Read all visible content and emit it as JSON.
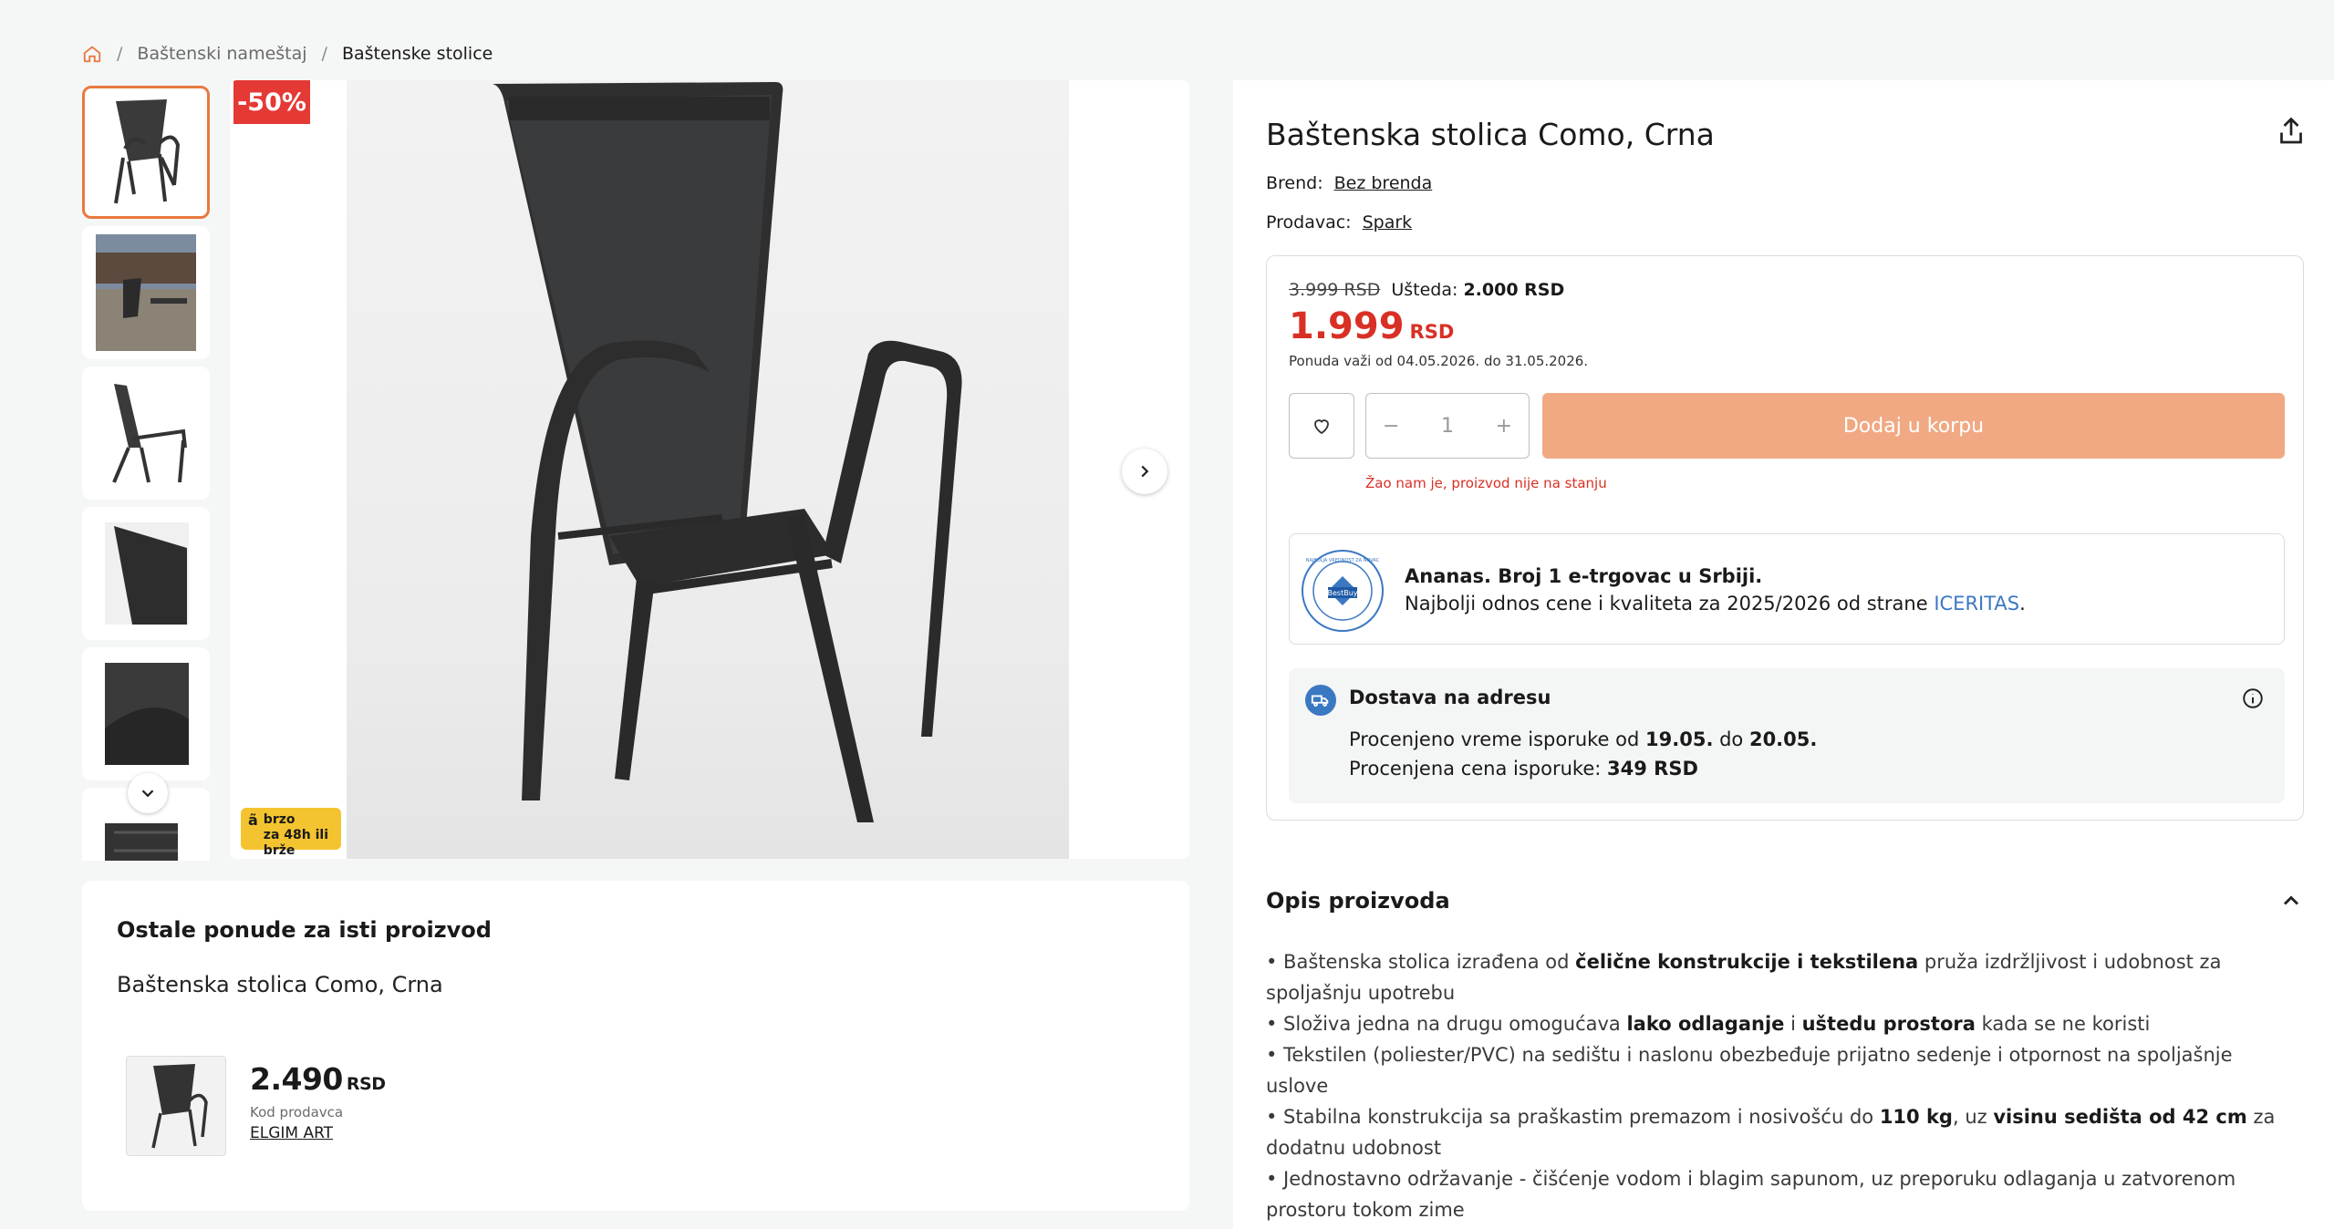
{
  "breadcrumb": {
    "items": [
      "Baštenski nameštaj",
      "Baštenske stolice"
    ]
  },
  "gallery": {
    "discount_badge": "-50%",
    "fast_badge_line1": "brzo",
    "fast_badge_line2": "za 48h ili brže",
    "fast_badge_logo": "ã"
  },
  "other_offers": {
    "title": "Ostale ponude za isti proizvod",
    "product_name": "Baštenska stolica Como, Crna",
    "offer": {
      "price": "2.490",
      "currency": "RSD",
      "seller_label": "Kod prodavca",
      "seller": "ELGIM ART"
    }
  },
  "product": {
    "title": "Baštenska stolica Como, Crna",
    "brand_label": "Brend:",
    "brand": "Bez brenda",
    "seller_label": "Prodavac:",
    "seller": "Spark"
  },
  "pricing": {
    "old_price": "3.999 RSD",
    "save_label": "Ušteda:",
    "save_value": "2.000 RSD",
    "price": "1.999",
    "currency": "RSD",
    "valid": "Ponuda važi od 04.05.2026. do 31.05.2026."
  },
  "cart": {
    "minus": "−",
    "quantity": "1",
    "plus": "+",
    "add_label": "Dodaj u korpu",
    "out_of_stock": "Žao nam je, proizvod nije na stanju"
  },
  "bestbuy": {
    "title": "Ananas. Broj 1 e-trgovac u Srbiji.",
    "subtitle_before": "Najbolji odnos cene i kvaliteta za 2025/2026 od strane ",
    "subtitle_link": "ICERITAS",
    "subtitle_after": ".",
    "badge_text": "BestBuy",
    "badge_ring_text": "NAJBOLJA VREDNOST ZA NOVAC"
  },
  "delivery": {
    "title": "Dostava na adresu",
    "time_label": "Procenjeno vreme isporuke od ",
    "time_from": "19.05.",
    "time_mid": " do ",
    "time_to": "20.05.",
    "cost_label": "Procenjena cena isporuke: ",
    "cost": "349 RSD"
  },
  "description": {
    "title": "Opis proizvoda",
    "items": [
      {
        "a": "• Baštenska stolica izrađena od ",
        "b": "čelične konstrukcije i tekstilena",
        "c": " pruža izdržljivost i udobnost za spoljašnju upotrebu"
      },
      {
        "a": "• Složiva jedna na drugu omogućava ",
        "b": "lako odlaganje",
        "c": " i ",
        "d": "uštedu prostora",
        "e": " kada se ne koristi"
      },
      {
        "a": "• Tekstilen (poliester/PVC) na sedištu i naslonu obezbeđuje prijatno sedenje i otpornost na spoljašnje uslove"
      },
      {
        "a": "• Stabilna konstrukcija sa praškastim premazom i nosivošću do ",
        "b": "110 kg",
        "c": ", uz ",
        "d": "visinu sedišta od 42 cm",
        "e": " za dodatnu udobnost"
      },
      {
        "a": "• Jednostavno održavanje - čišćenje vodom i blagim sapunom, uz preporuku odlaganja u zatvorenom prostoru tokom zime"
      }
    ]
  },
  "colors": {
    "accent": "#e8793d",
    "price_red": "#d93025",
    "cart_button": "#f0a983",
    "link_blue": "#3b78c2"
  }
}
